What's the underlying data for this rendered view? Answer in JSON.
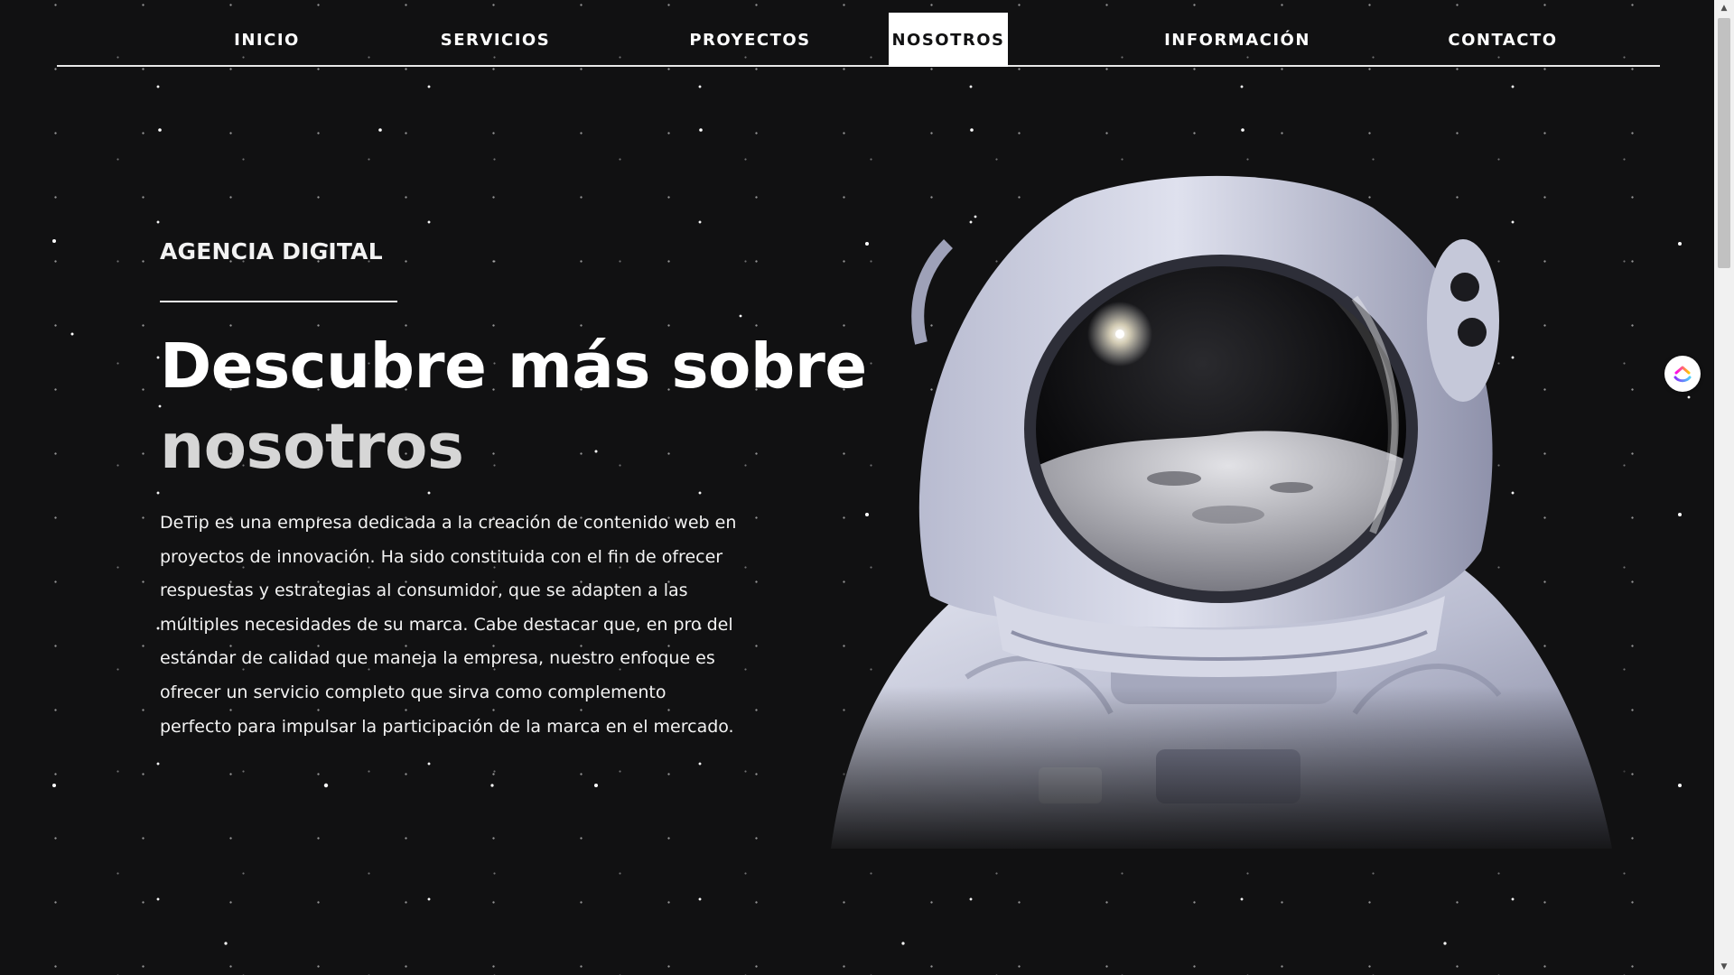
{
  "nav": {
    "items": [
      {
        "label": "INICIO",
        "active": false
      },
      {
        "label": "SERVICIOS",
        "active": false
      },
      {
        "label": "PROYECTOS",
        "active": false
      },
      {
        "label": "NOSOTROS",
        "active": true
      },
      {
        "label": "INFORMACIÓN",
        "active": false
      },
      {
        "label": "CONTACTO",
        "active": false
      }
    ]
  },
  "hero": {
    "eyebrow": "AGENCIA DIGITAL",
    "headline_line1": "Descubre más sobre",
    "headline_line2": "nosotros",
    "description": "DeTip es una empresa dedicada a la creación de contenido web en proyectos de innovación. Ha sido constituida con el fin de ofrecer respuestas y estrategias al consumidor, que se adapten a las múltiples necesidades de su marca. Cabe destacar que, en pro del estándar de calidad que maneja la empresa, nuestro enfoque es ofrecer un servicio completo que sirva como complemento perfecto para impulsar la participación de la marca en el mercado.",
    "image": "astronaut-illustration"
  },
  "widget": {
    "icon": "clickup-icon"
  },
  "colors": {
    "background": "#111112",
    "text": "#ffffff",
    "headline_secondary": "#d6d6d6",
    "active_nav_bg": "#ffffff",
    "suit": "#c9ccdc",
    "suit_shadow": "#8d90a8"
  }
}
